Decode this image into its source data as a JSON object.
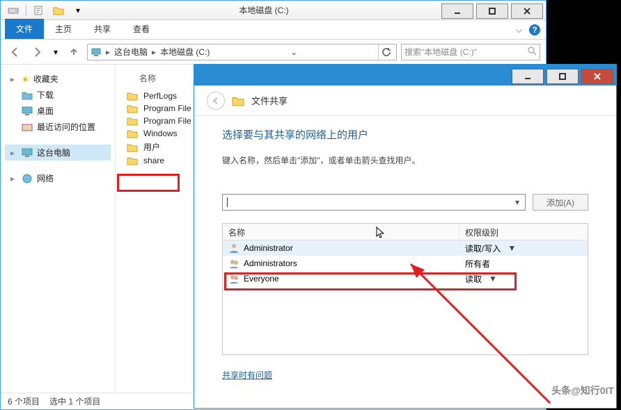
{
  "explorer": {
    "title": "本地磁盘 (C:)",
    "ribbon": {
      "file": "文件",
      "home": "主页",
      "share": "共享",
      "view": "查看"
    },
    "address": {
      "root": "这台电脑",
      "drive": "本地磁盘 (C:)"
    },
    "search_placeholder": "搜索\"本地磁盘 (C:)\"",
    "tree": {
      "favorites": "收藏夹",
      "downloads": "下载",
      "desktop": "桌面",
      "recent": "最近访问的位置",
      "this_pc": "这台电脑",
      "network": "网络"
    },
    "list": {
      "col_name": "名称",
      "items": [
        "PerfLogs",
        "Program File",
        "Program File",
        "Windows",
        "用户",
        "share"
      ]
    },
    "status": {
      "count": "6 个项目",
      "selection": "选中 1 个项目"
    }
  },
  "share_dialog": {
    "crumb_title": "文件共享",
    "heading": "选择要与其共享的网络上的用户",
    "hint": "键入名称，然后单击\"添加\"，或者单击箭头查找用户。",
    "add_button": "添加(A)",
    "grid": {
      "col_name": "名称",
      "col_perm": "权限级别",
      "rows": [
        {
          "name": "Administrator",
          "perm": "读取/写入",
          "caret": true
        },
        {
          "name": "Administrators",
          "perm": "所有者",
          "caret": false
        },
        {
          "name": "Everyone",
          "perm": "读取",
          "caret": true
        }
      ]
    },
    "trouble_link": "共享时有问题"
  },
  "watermark": "头条@知行0IT"
}
